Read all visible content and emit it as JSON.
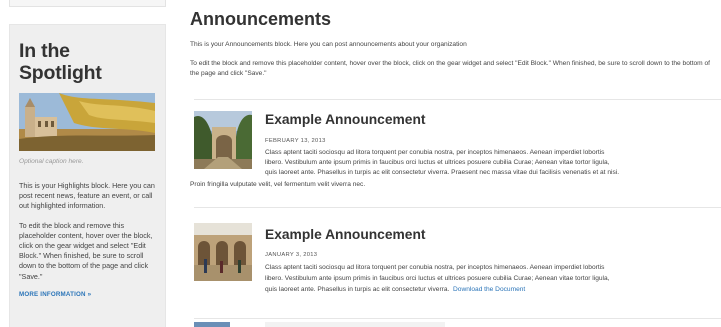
{
  "sidebar": {
    "title": "In the Spotlight",
    "caption": "Optional caption here.",
    "paragraphs": [
      "This is your Highlights block. Here you can post recent news, feature an event, or call out highlighted information.",
      "To edit the block and remove this placeholder content, hover over the block, click on the gear widget and select \"Edit Block.\" When finished, be sure to scroll down to the bottom of the page and click \"Save.\""
    ],
    "more_link": "MORE INFORMATION »"
  },
  "main": {
    "heading": "Announcements",
    "intro": [
      "This is your Announcements block. Here you can post announcements about your organization",
      "To edit the block and remove this placeholder content, hover over the block, click on the gear widget and select \"Edit Block.\" When finished, be sure to scroll down to the bottom of the page and click \"Save.\""
    ],
    "announcements": [
      {
        "title": "Example Announcement",
        "date": "FEBRUARY 13, 2013",
        "body_lines": [
          "Class aptent taciti sociosqu ad litora torquent per conubia nostra, per inceptos himenaeos. Aenean imperdiet lobortis",
          "libero. Vestibulum ante ipsum primis in faucibus orci luctus et ultrices posuere cubilia Curae; Aenean vitae tortor ligula,",
          "quis laoreet ante. Phasellus in turpis ac elit consectetur viverra. Praesent nec massa vitae dui facilisis venenatis et at nisi.",
          "Proin fringilla vulputate velit, vel fermentum velit viverra nec."
        ]
      },
      {
        "title": "Example Announcement",
        "date": "JANUARY 3, 2013",
        "body_lines": [
          "Class aptent taciti sociosqu ad litora torquent per conubia nostra, per inceptos himenaeos. Aenean imperdiet lobortis",
          "libero. Vestibulum ante ipsum primis in faucibus orci luctus et ultrices posuere cubilia Curae; Aenean vitae tortor ligula,",
          "quis laoreet ante. Phasellus in turpis ac elit consectetur viverra."
        ],
        "link": "Download the Document"
      }
    ]
  },
  "colors": {
    "link": "#2a74b8",
    "sidebar_bg": "#efefef",
    "text": "#333333"
  }
}
